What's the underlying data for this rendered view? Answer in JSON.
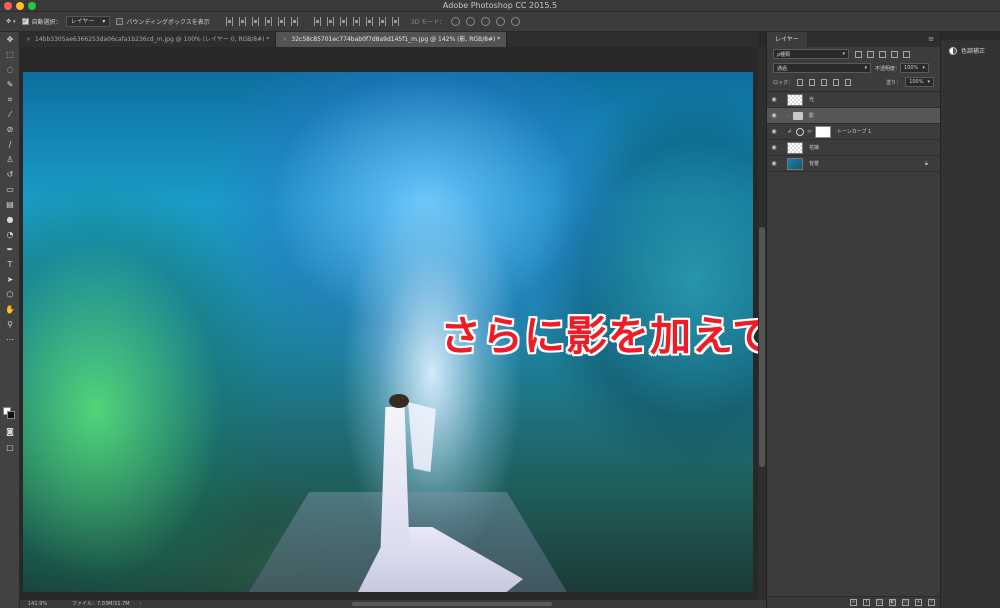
{
  "app": {
    "title": "Adobe Photoshop CC 2015.5",
    "colors": {
      "close": "#ff5f56",
      "minimize": "#ffbd2e",
      "zoom": "#27c93f"
    }
  },
  "options_bar": {
    "auto_select_label": "自動選択：",
    "auto_select_target": "レイヤー",
    "bounding_box_label": "バウンディングボックスを表示",
    "mode_3d_label": "3D モード："
  },
  "tabs": [
    {
      "label": "14bb3305ae6366253da06cafa1b236cd_m.jpg @ 100% (レイヤー 0, RGB/8#) *"
    },
    {
      "label": "32c58c85701ec774bab0f7d8a9d145f1_m.jpg @ 142% (影, RGB/8#) *"
    }
  ],
  "canvas": {
    "overlay_text": "さらに影を加えていく"
  },
  "status": {
    "zoom": "141.9%",
    "file_info": "ファイル：7.03M/31.7M"
  },
  "layers_panel": {
    "tab_label": "レイヤー",
    "kind_label": "ρ種類",
    "blend_mode": "通過",
    "opacity_label": "不透明度：",
    "opacity_value": "100%",
    "lock_label": "ロック：",
    "fill_label": "塗り：",
    "fill_value": "100%",
    "layers": [
      {
        "name": "光"
      },
      {
        "name": "影"
      },
      {
        "name": "トーンカーブ 1"
      },
      {
        "name": "花嫁"
      },
      {
        "name": "背景"
      }
    ]
  },
  "right_dock": {
    "item_label": "色調補正"
  }
}
